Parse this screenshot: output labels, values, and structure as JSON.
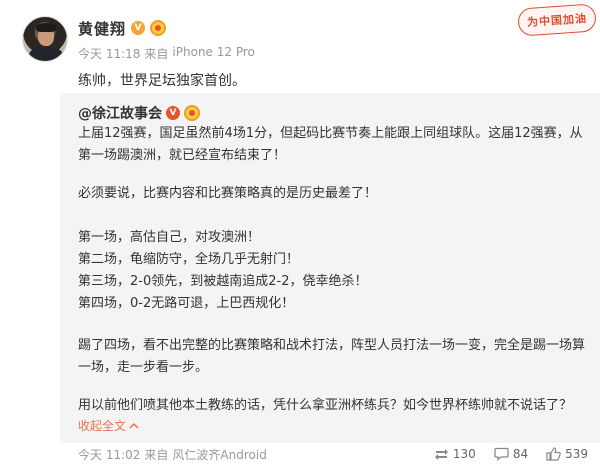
{
  "post": {
    "author": "黄健翔",
    "time": "今天 11:18",
    "source_prefix": "来自",
    "source": "iPhone 12 Pro",
    "text": "练帅，世界足坛独家首创。",
    "stamp": "为中国加油"
  },
  "repost": {
    "author": "@徐江故事会",
    "paragraphs": [
      "上届12强赛，国足虽然前4场1分，但起码比赛节奏上能跟上同组球队。这届12强赛，从第一场踢澳洲，就已经宣布结束了！",
      "必须要说，比赛内容和比赛策略真的是历史最差了！"
    ],
    "matches": [
      "第一场，高估自己，对攻澳洲！",
      "第二场，龟缩防守，全场几乎无射门！",
      "第三场，2-0领先，到被越南追成2-2，侥幸绝杀！",
      "第四场，0-2无路可退，上巴西规化！"
    ],
    "para_after": "踢了四场，看不出完整的比赛策略和战术打法，阵型人员打法一场一变，完全是踢一场算一场，走一步看一步。",
    "para_last": "用以前他们喷其他本土教练的话，凭什么拿亚洲杯练兵？如今世界杯练帅就不说话了？",
    "collapse_label": "收起全文",
    "time": "今天 11:02",
    "source_prefix": "来自",
    "source": "风仁波齐Android",
    "reposts": "130",
    "comments": "84",
    "likes": "539"
  },
  "colors": {
    "accent": "#eb7350",
    "badge": "#f7a23a",
    "meta": "#999999",
    "repost_bg": "#f4f4f4"
  },
  "icons": [
    "v-badge",
    "medal-icon",
    "chevron-up-icon",
    "repost-icon",
    "comment-icon",
    "like-icon"
  ]
}
